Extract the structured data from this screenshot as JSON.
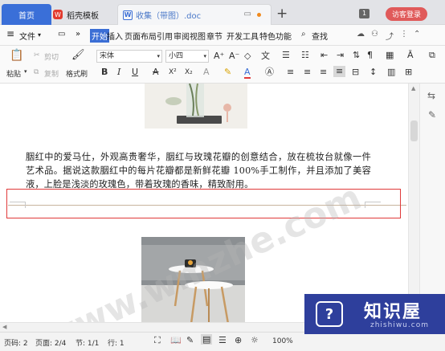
{
  "tabs": {
    "home": "首页",
    "template": "稻壳模板",
    "doc": "收集（带图）.doc"
  },
  "badge": "1",
  "login": "访客登录",
  "menu": {
    "hamburger": "≡",
    "file": "文件",
    "start": "开始",
    "insert": "插入",
    "layout": "页面布局",
    "ref": "引用",
    "review": "审阅",
    "view": "视图",
    "chapter": "章节",
    "devtools": "开发工具",
    "special": "特色功能",
    "search": "查找"
  },
  "toolbar": {
    "paste": "粘贴",
    "cut": "剪切",
    "copy": "复制",
    "format_painter": "格式刷",
    "font_name": "宋体",
    "font_size": "小四",
    "bold": "B",
    "italic": "I",
    "underline": "U",
    "strike": "A"
  },
  "doc": {
    "paragraph": "胭红中的爱马仕，外观高贵奢华，胭红与玫瑰花瓣的创意结合，放在梳妆台就像一件艺术品。据说这款胭红中的每片花瓣都是新鲜花瓣 100%手工制作，并且添加了美容液，上脸是浅淡的玫瑰色，带着玫瑰的香味，精致耐用。"
  },
  "watermark": "www.wmzhe.com",
  "status": {
    "page_num": "页码: 2",
    "page_of": "页面: 2/4",
    "section": "节: 1/1",
    "line": "行: 1",
    "zoom": "100%"
  },
  "brand": {
    "logo_char": "?",
    "name": "知识屋",
    "url": "zhishiwu.com",
    "bg": "#2e3f9c"
  },
  "colors": {
    "accent": "#3b6ed5",
    "highlight_box": "#e03a3a",
    "login": "#e05a5a"
  }
}
